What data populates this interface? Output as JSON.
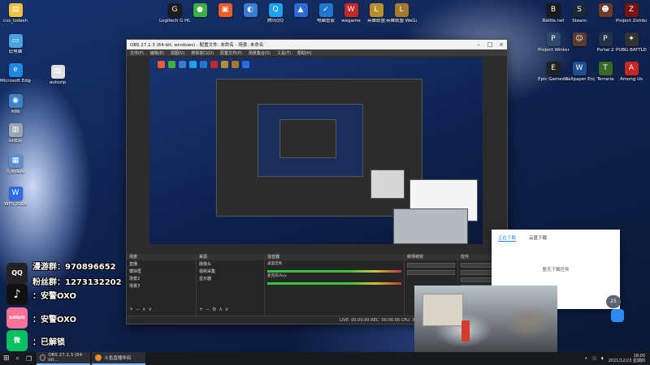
{
  "desktop_left_icons": [
    {
      "label": "Logitech G HUB",
      "color": "#1b1b1b",
      "glyph": "G"
    },
    {
      "label": "",
      "color": "#3cb043",
      "glyph": "●"
    },
    {
      "label": "",
      "color": "#e85d2a",
      "glyph": "▣"
    },
    {
      "label": "",
      "color": "#3a7bd5",
      "glyph": "◐"
    },
    {
      "label": "腾讯QQ",
      "color": "#1da1f2",
      "glyph": "Q"
    },
    {
      "label": "",
      "color": "#2c6bd6",
      "glyph": "▲"
    },
    {
      "label": "电脑管家",
      "color": "#1f77d0",
      "glyph": "✓"
    },
    {
      "label": "wegame",
      "color": "#c62828",
      "glyph": "W"
    },
    {
      "label": "英雄联盟",
      "color": "#b8902b",
      "glyph": "L"
    },
    {
      "label": "英雄联盟 WeGame版",
      "color": "#a37b2a",
      "glyph": "L"
    }
  ],
  "desktop_column_icons": [
    {
      "label": "cvs_lodash",
      "color": "#f0c040",
      "glyph": "▤"
    },
    {
      "label": "此电脑",
      "color": "#4aa3df",
      "glyph": "▭"
    },
    {
      "label": "autozip",
      "color": "#e0e0e0",
      "glyph": "▤"
    },
    {
      "label": "Microsoft Edge",
      "color": "#1e88e5",
      "glyph": "e"
    },
    {
      "label": "网络",
      "color": "#3d82c4",
      "glyph": "◉"
    },
    {
      "label": "回收站",
      "color": "#9aa7b0",
      "glyph": "▥"
    },
    {
      "label": "控制面板",
      "color": "#5e8fd0",
      "glyph": "▦"
    },
    {
      "label": "WPS 2019",
      "color": "#2e6be6",
      "glyph": "W"
    }
  ],
  "desktop_right_icons": [
    {
      "label": "Battle.net",
      "color": "#1a1a1a",
      "glyph": "B"
    },
    {
      "label": "Steam",
      "color": "#1b2838",
      "glyph": "S"
    },
    {
      "label": "",
      "color": "#6b3a2a",
      "glyph": "☻"
    },
    {
      "label": "Project Zomboid",
      "color": "#7a1212",
      "glyph": "Z"
    },
    {
      "label": "Project Winter",
      "color": "#2f4a6a",
      "glyph": "P"
    },
    {
      "label": "",
      "color": "#5a3a2a",
      "glyph": "☺"
    },
    {
      "label": "Portal 2",
      "color": "#22344a",
      "glyph": "P"
    },
    {
      "label": "PUBG BATTLEGR...",
      "color": "#333333",
      "glyph": "✦"
    },
    {
      "label": "Epic Games Launcher",
      "color": "#222222",
      "glyph": "E"
    },
    {
      "label": "Wallpaper Engine",
      "color": "#1e4f8c",
      "glyph": "W"
    },
    {
      "label": "Terraria",
      "color": "#3a6a2a",
      "glyph": "T"
    },
    {
      "label": "Among Us",
      "color": "#c62828",
      "glyph": "A"
    }
  ],
  "obs": {
    "title": "OBS 27.1.3 (64-bit, windows) - 配置文件: 未命名 - 场景: 未命名",
    "menu": [
      "文件(F)",
      "编辑(E)",
      "视图(V)",
      "停靠窗口(D)",
      "配置文件(P)",
      "场景集合(S)",
      "工具(T)",
      "帮助(H)"
    ],
    "docks": {
      "scenes_header": "场景",
      "scenes": [
        "直播",
        "模拟框",
        "场景2",
        "场景3"
      ],
      "sources_header": "来源",
      "sources": [
        "摄像头",
        "视频采集",
        "显示器"
      ],
      "mixer_header": "混音器",
      "mixer_rows": [
        "桌面音频",
        "麦克风/Aux"
      ],
      "transitions_header": "转场特效",
      "controls_header": "控件"
    },
    "status": "LIVE: 00:00:00   REC: 00:00:00   CPU: 3.2%, 60.00 fps"
  },
  "overlay": {
    "qq_label": "QQ",
    "qq_text": "漫游群：970896652",
    "fan_text": "粉丝群：1273132202",
    "tiktok_label": "♪",
    "tiktok_text": "：安警OXO",
    "bili_label": "bilibili",
    "bili_text": "：安警OXO",
    "wechat_label": "微",
    "wechat_text": "：已解锁"
  },
  "download_panel": {
    "tab_active": "正在下载",
    "tab_other": "云盘下载",
    "empty_text": "暂无下载任务",
    "badge": "25"
  },
  "taskbar": {
    "apps": [
      "OBS 27.1.3 (64-bit...",
      "斗鱼直播伴侣"
    ],
    "time": "18:00",
    "date": "2021/12/23 星期四"
  }
}
